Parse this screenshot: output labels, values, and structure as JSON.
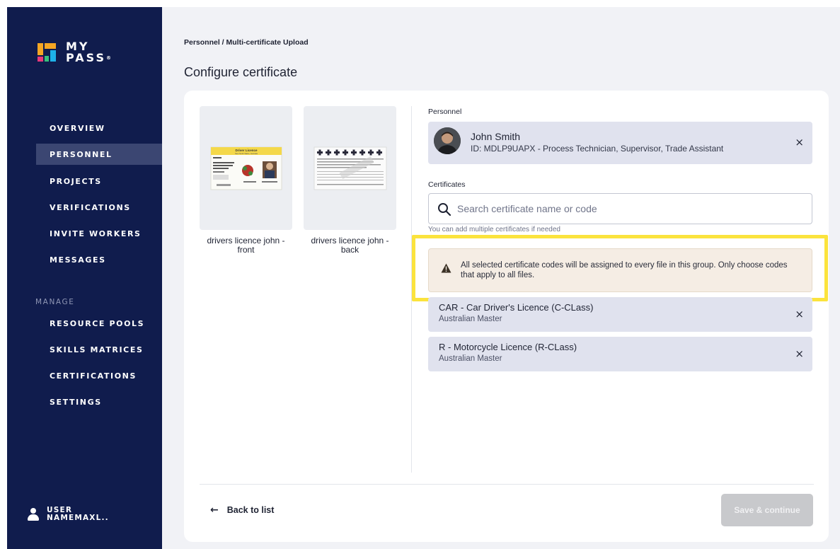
{
  "brand": {
    "line1": "MY",
    "line2": "PASS",
    "mark": "®"
  },
  "nav": {
    "items": [
      "OVERVIEW",
      "PERSONNEL",
      "PROJECTS",
      "VERIFICATIONS",
      "INVITE WORKERS",
      "MESSAGES"
    ],
    "section_label": "MANAGE",
    "manage_items": [
      "RESOURCE POOLS",
      "SKILLS MATRICES",
      "CERTIFICATIONS",
      "SETTINGS"
    ],
    "active": "PERSONNEL"
  },
  "user": {
    "line1": "USER",
    "line2": "NAMEMAXL.."
  },
  "breadcrumb": "Personnel / Multi-certificate Upload",
  "title": "Configure certificate",
  "files": [
    {
      "label": "drivers licence john - front",
      "card_header": "Driver Licence",
      "card_region": "New South Wales, Australia"
    },
    {
      "label": "drivers licence john - back"
    }
  ],
  "personnel": {
    "label": "Personnel",
    "name": "John Smith",
    "id_line": "ID: MDLP9UAPX - Process Technician, Supervisor, Trade Assistant"
  },
  "certificates": {
    "label": "Certificates",
    "search_placeholder": "Search certificate name or code",
    "hint": "You can add multiple certificates if needed",
    "warning": "All selected certificate codes will be assigned to every file in this group. Only choose codes that apply to all files.",
    "selected": [
      {
        "title": "CAR - Car Driver's Licence (C-CLass)",
        "subtitle": "Australian Master"
      },
      {
        "title": "R - Motorcycle Licence (R-CLass)",
        "subtitle": "Australian Master"
      }
    ]
  },
  "footer": {
    "back": "Back to list",
    "save": "Save & continue"
  },
  "colors": {
    "sidebar": "#101c4d",
    "active_nav": "#3b4672",
    "highlight": "#fbe33d",
    "warning_bg": "#f5ede4",
    "chip_bg": "#e0e2ee"
  }
}
